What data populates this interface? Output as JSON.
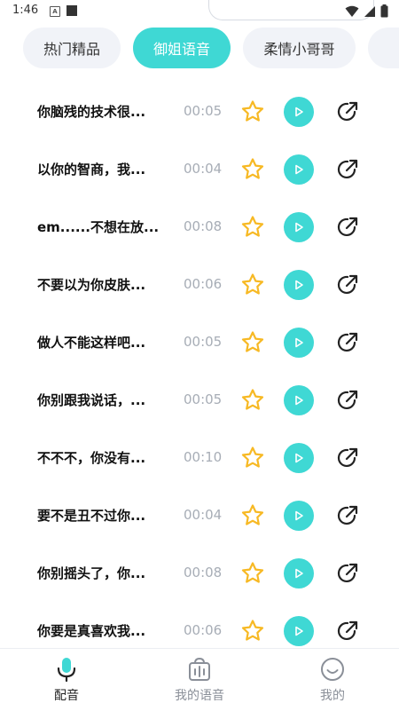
{
  "status_bar": {
    "time": "1:46",
    "indicator_letter": "A"
  },
  "tabs": [
    {
      "label": "热门精品",
      "active": false
    },
    {
      "label": "御姐语音",
      "active": true
    },
    {
      "label": "柔情小哥哥",
      "active": false
    }
  ],
  "items": [
    {
      "title": "你脑残的技术很...",
      "duration": "00:05"
    },
    {
      "title": "以你的智商，我...",
      "duration": "00:04"
    },
    {
      "title": "em......不想在放...",
      "duration": "00:08"
    },
    {
      "title": "不要以为你皮肤...",
      "duration": "00:06"
    },
    {
      "title": "做人不能这样吧...",
      "duration": "00:05"
    },
    {
      "title": "你别跟我说话，...",
      "duration": "00:05"
    },
    {
      "title": "不不不，你没有...",
      "duration": "00:10"
    },
    {
      "title": "要不是丑不过你...",
      "duration": "00:04"
    },
    {
      "title": "你别摇头了，你...",
      "duration": "00:08"
    },
    {
      "title": "你要是真喜欢我...",
      "duration": "00:06"
    }
  ],
  "bottom_nav": [
    {
      "label": "配音",
      "icon": "microphone-icon",
      "active": true
    },
    {
      "label": "我的语音",
      "icon": "voice-bag-icon",
      "active": false
    },
    {
      "label": "我的",
      "icon": "smile-face-icon",
      "active": false
    }
  ],
  "colors": {
    "accent": "#3fd8d4",
    "star": "#f7b924",
    "tab_bg": "#f1f3f8",
    "muted": "#a7adb6"
  }
}
